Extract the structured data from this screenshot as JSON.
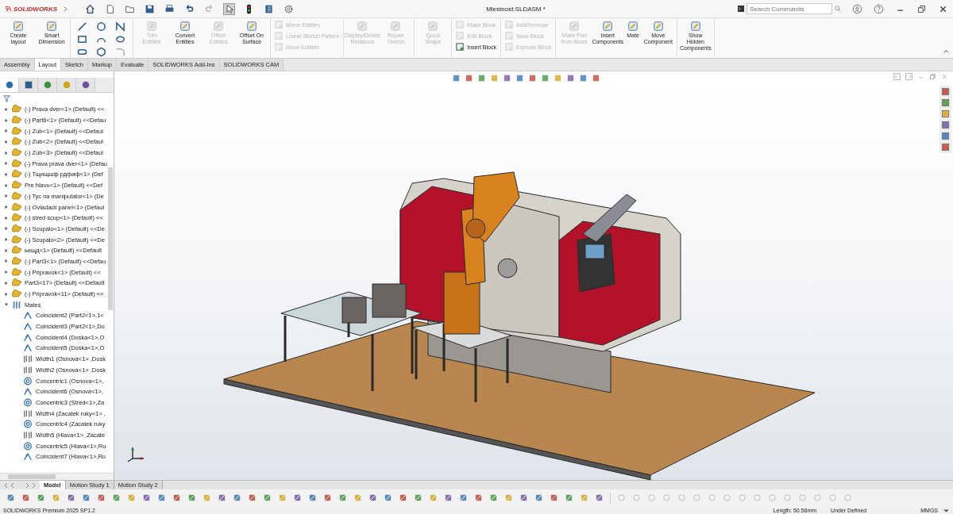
{
  "app": {
    "name": "SOLIDWORKS",
    "document_title": "Miestnost.SLDASM *"
  },
  "search": {
    "placeholder": "Search Commands"
  },
  "ribbon": {
    "groups": [
      {
        "kind": "buttons",
        "items": [
          {
            "label": "Create layout",
            "disabled": false
          },
          {
            "label": "Smart Dimension",
            "disabled": false
          }
        ]
      },
      {
        "kind": "sketch-tools"
      },
      {
        "kind": "buttons",
        "items": [
          {
            "label": "Trim Entities",
            "disabled": true
          },
          {
            "label": "Convert Entities",
            "disabled": false
          },
          {
            "label": "Offset Entities",
            "disabled": true
          },
          {
            "label": "Offset On Surface",
            "disabled": false
          }
        ]
      },
      {
        "kind": "stack",
        "items": [
          {
            "label": "Mirror Entities",
            "disabled": true
          },
          {
            "label": "Linear Sketch Pattern",
            "disabled": true
          },
          {
            "label": "Move Entities",
            "disabled": true
          }
        ]
      },
      {
        "kind": "buttons",
        "items": [
          {
            "label": "Display/Delete Relations",
            "disabled": true
          },
          {
            "label": "Repair Sketch",
            "disabled": true
          }
        ]
      },
      {
        "kind": "buttons",
        "items": [
          {
            "label": "Quick Snaps",
            "disabled": true
          }
        ]
      },
      {
        "kind": "stack",
        "items": [
          {
            "label": "Make Block",
            "disabled": true
          },
          {
            "label": "Edit Block",
            "disabled": true
          },
          {
            "label": "Insert Block",
            "disabled": false
          }
        ]
      },
      {
        "kind": "stack",
        "items": [
          {
            "label": "Add/Remove",
            "disabled": true
          },
          {
            "label": "Save Block",
            "disabled": true
          },
          {
            "label": "Explode Block",
            "disabled": true
          }
        ]
      },
      {
        "kind": "buttons",
        "items": [
          {
            "label": "Make Part from Block",
            "disabled": true
          },
          {
            "label": "Insert Components",
            "disabled": false
          },
          {
            "label": "Mate",
            "disabled": false
          },
          {
            "label": "Move Component",
            "disabled": false
          }
        ]
      },
      {
        "kind": "buttons",
        "items": [
          {
            "label": "Show Hidden Components",
            "disabled": false
          }
        ]
      }
    ]
  },
  "tabs": [
    {
      "label": "Assembly",
      "selected": false
    },
    {
      "label": "Layout",
      "selected": true
    },
    {
      "label": "Sketch",
      "selected": false
    },
    {
      "label": "Markup",
      "selected": false
    },
    {
      "label": "Evaluate",
      "selected": false
    },
    {
      "label": "SOLIDWORKS Add-Ins",
      "selected": false
    },
    {
      "label": "SOLIDWORKS CAM",
      "selected": false
    }
  ],
  "panel_tabs": [
    {
      "selected": true
    },
    {
      "selected": false
    },
    {
      "selected": false
    },
    {
      "selected": false
    },
    {
      "selected": false
    }
  ],
  "tree": [
    {
      "label": "(-) Prava dver<1> (Default) <<",
      "expanded": false
    },
    {
      "label": "(-) Part6<1> (Default) <<Defau",
      "expanded": false
    },
    {
      "label": "(-) Zub<1> (Default) <<Defaul",
      "expanded": false
    },
    {
      "label": "(-) Zub<2> (Default) <<Defaul",
      "expanded": false
    },
    {
      "label": "(-) Zub<3> (Default) <<Defaul",
      "expanded": false
    },
    {
      "label": "(-) Prava prava dver<1> (Defau",
      "expanded": false
    },
    {
      "label": "(-) Тщищшф рдфиф<1> (Def",
      "expanded": false
    },
    {
      "label": "Pre hlavu<1> (Default) <<Def",
      "expanded": false
    },
    {
      "label": "(-) Tyc na manipulator<1> (De",
      "expanded": false
    },
    {
      "label": "(-) Ovladacii panel<1> (Defaul",
      "expanded": false
    },
    {
      "label": "(-) stred scup<1> (Default) <<",
      "expanded": false
    },
    {
      "label": "(-) Scupalo<1> (Default) <<De",
      "expanded": false
    },
    {
      "label": "(-) Scupalo<2> (Default) <<De",
      "expanded": false
    },
    {
      "label": "ьещд<1> (Default) <<Default",
      "expanded": false
    },
    {
      "label": "(-) Part3<1> (Default) <<Defau",
      "expanded": false
    },
    {
      "label": "(-) Pripravok<1> (Default) <<",
      "expanded": false
    },
    {
      "label": "Part3<17> (Default) <<Default",
      "expanded": false
    },
    {
      "label": "(-) Pripravok<11> (Default) <<",
      "expanded": false
    }
  ],
  "mates": {
    "label": "Mates",
    "expanded": true,
    "children": [
      {
        "kind": "coincident",
        "label": "Coincident2 (Part2<1>,1<"
      },
      {
        "kind": "coincident",
        "label": "Coincident3 (Part2<1>,Do"
      },
      {
        "kind": "coincident",
        "label": "Coincident4 (Doska<1>,O"
      },
      {
        "kind": "coincident",
        "label": "Coincident5 (Doska<1>,O"
      },
      {
        "kind": "width",
        "label": "Width1 (Osnova<1> ,Dosk"
      },
      {
        "kind": "width",
        "label": "Width2 (Osnova<1> ,Dosk"
      },
      {
        "kind": "concentric",
        "label": "Concentric1 (Osnova<1>,"
      },
      {
        "kind": "coincident",
        "label": "Coincident6 (Osnova<1>,"
      },
      {
        "kind": "concentric",
        "label": "Concentric3 (Stred<1>,Za"
      },
      {
        "kind": "width",
        "label": "Width4 (Zacatek ruky<1> ,"
      },
      {
        "kind": "concentric",
        "label": "Concentric4 (Zacatek ruky"
      },
      {
        "kind": "width",
        "label": "Width5 (Hlava<1> ,Zacate"
      },
      {
        "kind": "concentric",
        "label": "Concentric5 (Hlava<1>,Ru"
      },
      {
        "kind": "coincident",
        "label": "Coincident7 (Hlava<1>,Ru"
      }
    ]
  },
  "bottom_tabs": [
    {
      "label": "Model",
      "selected": true
    },
    {
      "label": "Motion Study 1",
      "selected": false
    },
    {
      "label": "Motion Study 2",
      "selected": false
    }
  ],
  "status_bar": {
    "product": "SOLIDWORKS Premium 2025 SP1.2",
    "length": "Length: 50.58mm",
    "state": "Under Defined",
    "units": "MMGS"
  }
}
